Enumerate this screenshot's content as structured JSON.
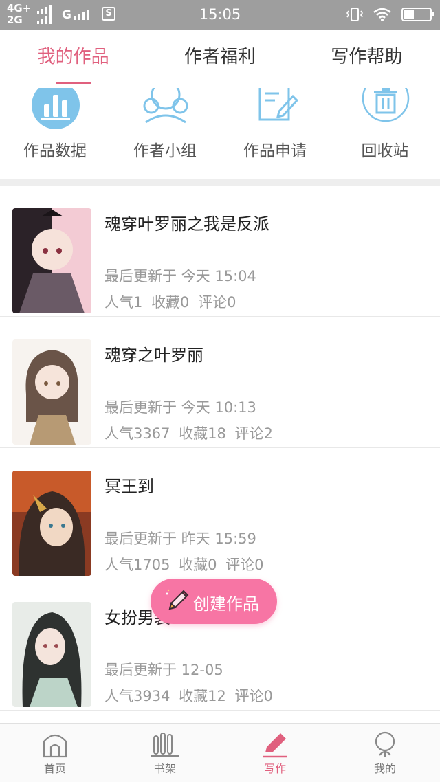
{
  "status_bar": {
    "network_1": "4G+",
    "network_2": "2G",
    "network_3": "G",
    "sim_badge": "S",
    "time": "15:05"
  },
  "tabs": [
    {
      "label": "我的作品",
      "active": true
    },
    {
      "label": "作者福利",
      "active": false
    },
    {
      "label": "写作帮助",
      "active": false
    }
  ],
  "quick_actions": [
    {
      "label": "作品数据",
      "icon": "bar-chart-icon"
    },
    {
      "label": "作者小组",
      "icon": "group-icon"
    },
    {
      "label": "作品申请",
      "icon": "edit-document-icon"
    },
    {
      "label": "回收站",
      "icon": "trash-icon"
    }
  ],
  "works": [
    {
      "title": "魂穿叶罗丽之我是反派",
      "updated": "最后更新于 今天 15:04",
      "stats": "人气1 收藏0 评论0"
    },
    {
      "title": "魂穿之叶罗丽",
      "updated": "最后更新于 今天 10:13",
      "stats": "人气3367 收藏18 评论2"
    },
    {
      "title": "冥王到",
      "updated": "最后更新于 昨天 15:59",
      "stats": "人气1705 收藏0 评论0"
    },
    {
      "title": "女扮男装",
      "updated": "最后更新于 12-05",
      "stats": "人气3934 收藏12 评论0"
    }
  ],
  "create_button": {
    "label": "创建作品"
  },
  "bottom_nav": [
    {
      "label": "首页",
      "icon": "home-icon",
      "active": false
    },
    {
      "label": "书架",
      "icon": "bookshelf-icon",
      "active": false
    },
    {
      "label": "写作",
      "icon": "pencil-icon",
      "active": true
    },
    {
      "label": "我的",
      "icon": "profile-icon",
      "active": false
    }
  ],
  "colors": {
    "accent": "#e0607e",
    "create_button": "#f775a4",
    "icon_blue": "#7fc4ea",
    "status_bar": "#9e9e9e"
  }
}
